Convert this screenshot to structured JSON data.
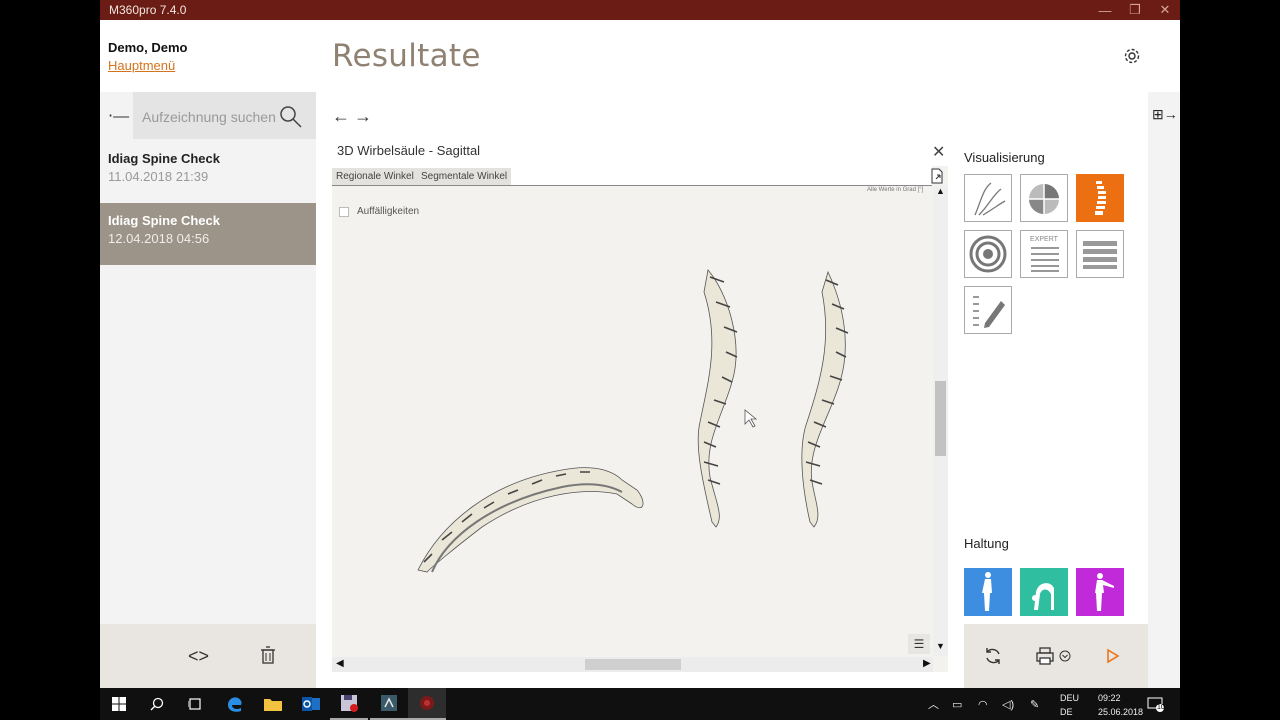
{
  "window": {
    "title": "M360pro 7.4.0"
  },
  "header": {
    "user": "Demo, Demo",
    "home_link": "Hauptmenü",
    "page_title": "Resultate"
  },
  "search": {
    "placeholder": "Aufzeichnung suchen"
  },
  "records": [
    {
      "name": "Idiag Spine Check",
      "date": "11.04.2018 21:39",
      "selected": false
    },
    {
      "name": "Idiag Spine Check",
      "date": "12.04.2018 04:56",
      "selected": true
    }
  ],
  "panel": {
    "title": "3D Wirbelsäule - Sagittal",
    "tabs": [
      "Regionale Winkel",
      "Segmentale Winkel"
    ],
    "units_note": "Alle Werte in Grad [°]",
    "abnormalities_label": "Auffälligkeiten"
  },
  "visualization": {
    "title": "Visualisierung",
    "tiles": [
      "curves-icon",
      "pie-chart-icon",
      "spine-icon",
      "rings-icon",
      "expert-list-icon",
      "stripes-icon",
      "notes-edit-icon"
    ],
    "expert_label": "EXPERT",
    "active_tile": "spine-icon"
  },
  "posture": {
    "title": "Haltung",
    "tiles": [
      {
        "icon": "standing-icon",
        "color": "#3d8ee0"
      },
      {
        "icon": "bending-icon",
        "color": "#2fbfa0"
      },
      {
        "icon": "arms-forward-icon",
        "color": "#c02ad8"
      }
    ]
  },
  "colors": {
    "titlebar": "#6b1c14",
    "accent": "#ec7012",
    "link": "#d4731e"
  },
  "taskbar": {
    "lang_line1": "DEU",
    "lang_line2": "DE",
    "time": "09:22",
    "date": "25.06.2018",
    "notifications": "10"
  }
}
